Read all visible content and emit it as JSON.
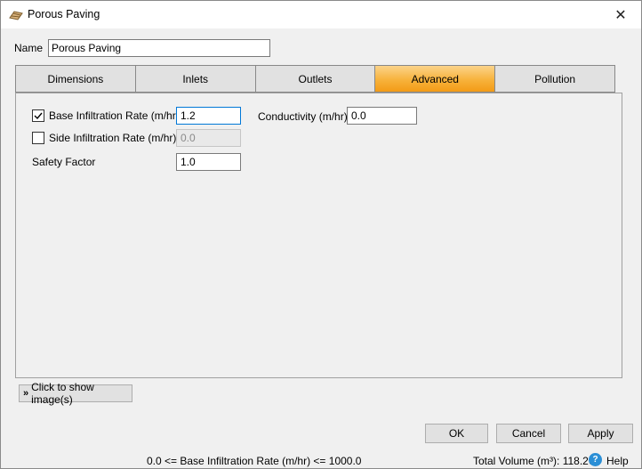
{
  "window": {
    "title": "Porous Paving",
    "close_glyph": "✕",
    "icon": "porous-paving-icon"
  },
  "name": {
    "label": "Name",
    "value": "Porous Paving"
  },
  "tabs": [
    {
      "label": "Dimensions",
      "active": false
    },
    {
      "label": "Inlets",
      "active": false
    },
    {
      "label": "Outlets",
      "active": false
    },
    {
      "label": "Advanced",
      "active": true
    },
    {
      "label": "Pollution",
      "active": false
    }
  ],
  "advanced": {
    "base_infiltration": {
      "label": "Base Infiltration Rate (m/hr)",
      "checked": true,
      "value": "1.2"
    },
    "side_infiltration": {
      "label": "Side Infiltration Rate (m/hr)",
      "checked": false,
      "value": "0.0"
    },
    "safety_factor": {
      "label": "Safety Factor",
      "value": "1.0"
    },
    "conductivity": {
      "label": "Conductivity (m/hr)",
      "value": "0.0"
    }
  },
  "show_images_button": {
    "label": "Click to show image(s)"
  },
  "buttons": {
    "ok": "OK",
    "cancel": "Cancel",
    "apply": "Apply"
  },
  "status": {
    "hint": "0.0 <= Base Infiltration Rate (m/hr) <= 1000.0",
    "total_volume": "Total Volume (m³): 118.263",
    "help": "Help"
  },
  "colors": {
    "active_tab": "#f7b23b",
    "focus_border": "#0078d7",
    "help_icon": "#2b8fd6"
  }
}
